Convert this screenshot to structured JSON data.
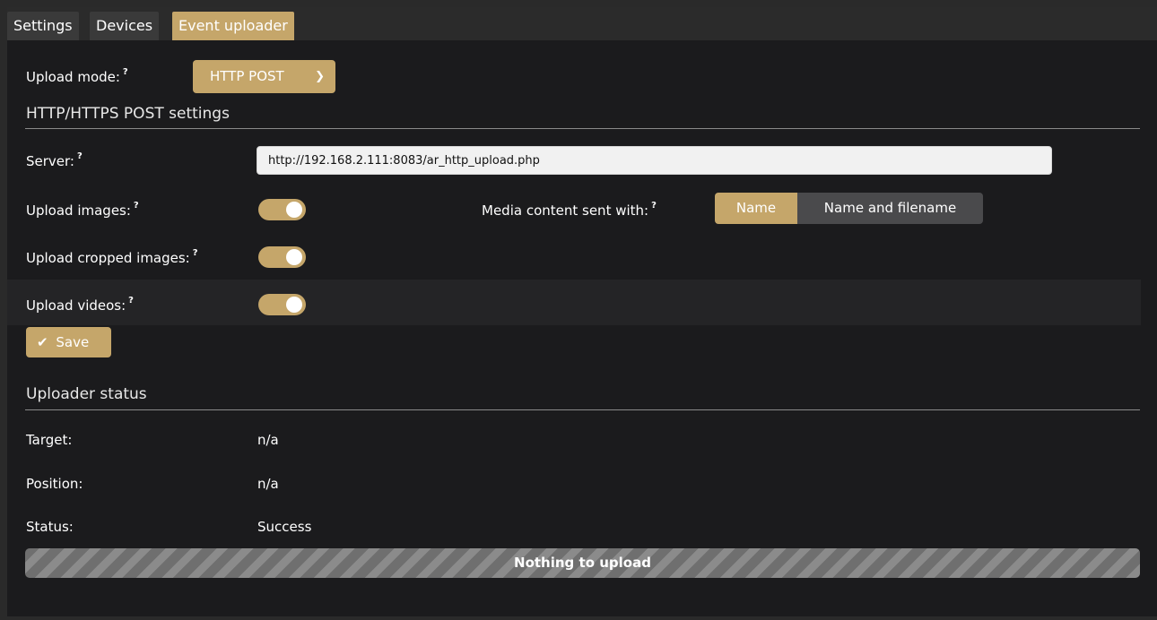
{
  "tabs": [
    {
      "label": "Settings"
    },
    {
      "label": "Devices"
    },
    {
      "label": "Event uploader"
    }
  ],
  "upload_mode": {
    "label": "Upload mode:",
    "help": "?",
    "value": "HTTP POST"
  },
  "post_settings": {
    "title": "HTTP/HTTPS POST settings",
    "server": {
      "label": "Server:",
      "help": "?",
      "value": "http://192.168.2.111:8083/ar_http_upload.php"
    },
    "upload_images": {
      "label": "Upload images:",
      "help": "?",
      "on": true
    },
    "upload_cropped": {
      "label": "Upload cropped images:",
      "help": "?",
      "on": true
    },
    "upload_videos": {
      "label": "Upload videos:",
      "help": "?",
      "on": true
    },
    "media_content": {
      "label": "Media content sent with:",
      "help": "?",
      "options": [
        "Name",
        "Name and filename"
      ],
      "selected": "Name"
    }
  },
  "save_label": "Save",
  "status": {
    "title": "Uploader status",
    "target": {
      "label": "Target:",
      "value": "n/a"
    },
    "position": {
      "label": "Position:",
      "value": "n/a"
    },
    "state": {
      "label": "Status:",
      "value": "Success"
    },
    "progress": {
      "text": "Nothing to upload",
      "percent": 0
    }
  },
  "colors": {
    "accent": "#c5a66a",
    "panel": "#1b1b1d",
    "segment_inactive": "#4a4a4c"
  }
}
